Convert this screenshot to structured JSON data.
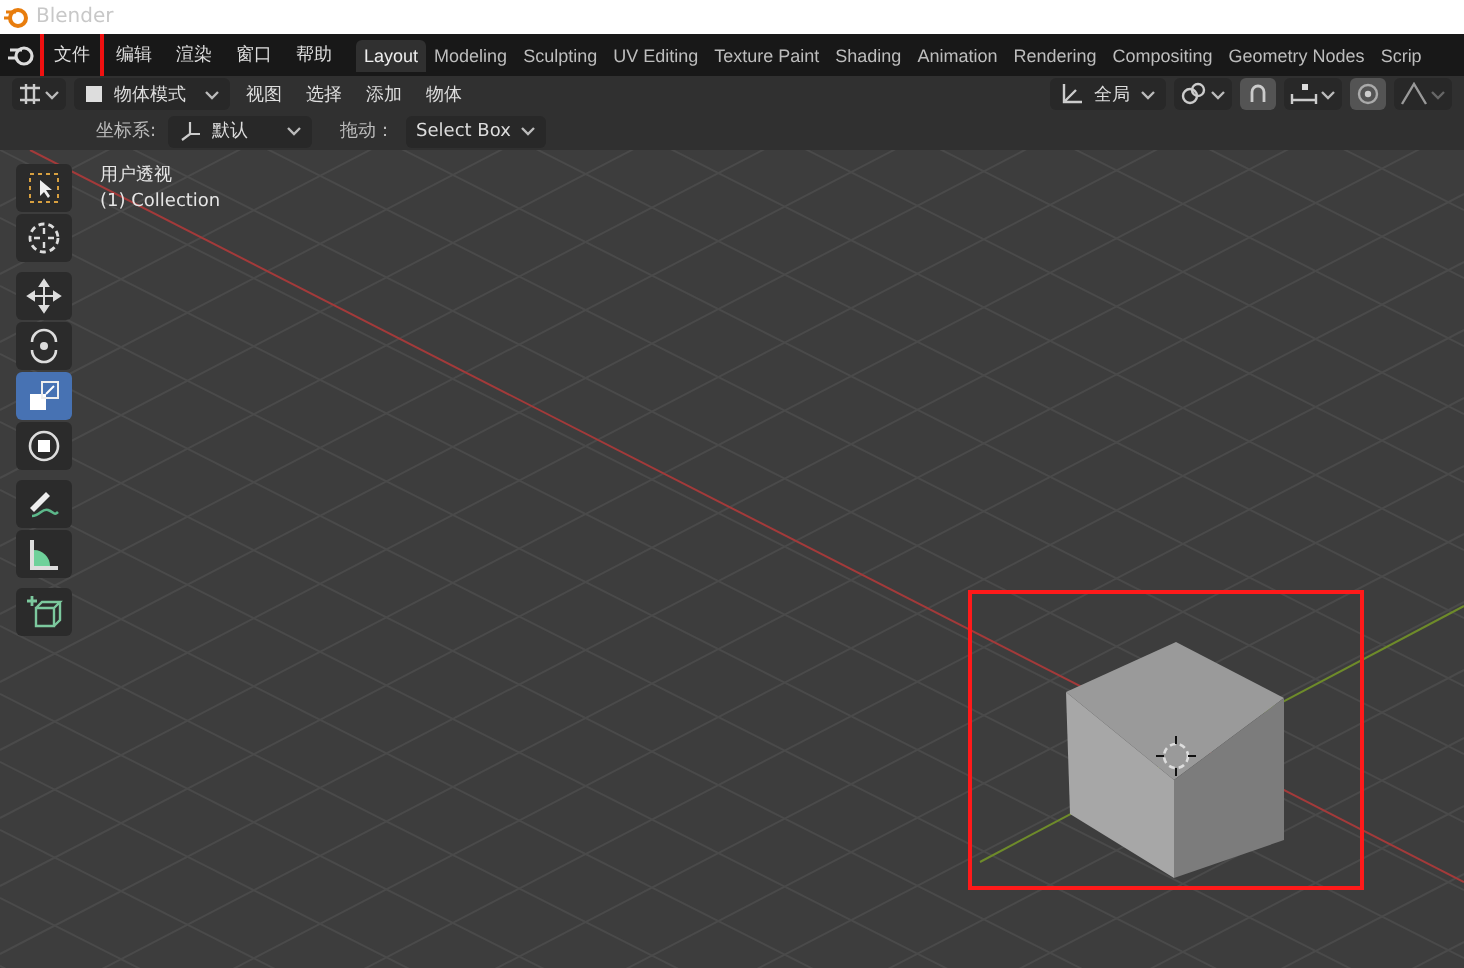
{
  "window": {
    "title": "Blender"
  },
  "menu": [
    {
      "label": "文件",
      "highlighted": true
    },
    {
      "label": "编辑",
      "highlighted": false
    },
    {
      "label": "渲染",
      "highlighted": false
    },
    {
      "label": "窗口",
      "highlighted": false
    },
    {
      "label": "帮助",
      "highlighted": false
    }
  ],
  "workspaces": [
    {
      "label": "Layout",
      "selected": true
    },
    {
      "label": "Modeling",
      "selected": false
    },
    {
      "label": "Sculpting",
      "selected": false
    },
    {
      "label": "UV Editing",
      "selected": false
    },
    {
      "label": "Texture Paint",
      "selected": false
    },
    {
      "label": "Shading",
      "selected": false
    },
    {
      "label": "Animation",
      "selected": false
    },
    {
      "label": "Rendering",
      "selected": false
    },
    {
      "label": "Compositing",
      "selected": false
    },
    {
      "label": "Geometry Nodes",
      "selected": false
    },
    {
      "label": "Scrip",
      "selected": false
    }
  ],
  "header": {
    "mode": "物体模式",
    "menus": [
      "视图",
      "选择",
      "添加",
      "物体"
    ],
    "orientation": "全局"
  },
  "tool_settings": {
    "coord_label": "坐标系:",
    "coord_value": "默认",
    "drag_label": "拖动：",
    "drag_value": "Select Box"
  },
  "tools": [
    {
      "kind": "select",
      "selected": false,
      "gap_before": false
    },
    {
      "kind": "cursor",
      "selected": false,
      "gap_before": false
    },
    {
      "kind": "move",
      "selected": false,
      "gap_before": true
    },
    {
      "kind": "rotate",
      "selected": false,
      "gap_before": false
    },
    {
      "kind": "scale",
      "selected": true,
      "gap_before": false
    },
    {
      "kind": "transform",
      "selected": false,
      "gap_before": false
    },
    {
      "kind": "annotate",
      "selected": false,
      "gap_before": true
    },
    {
      "kind": "measure",
      "selected": false,
      "gap_before": false
    },
    {
      "kind": "add-cube",
      "selected": false,
      "gap_before": true
    }
  ],
  "viewport": {
    "view_name": "用户透视",
    "collection": "(1) Collection",
    "cube_highlighted": true
  }
}
